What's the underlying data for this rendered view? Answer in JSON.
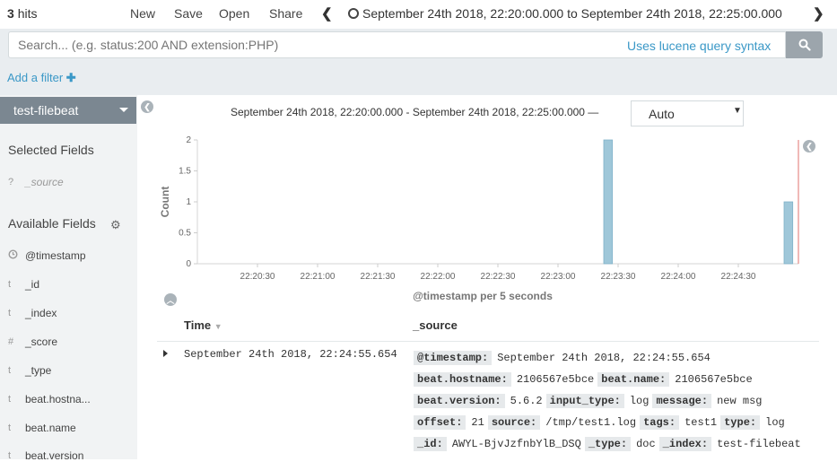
{
  "topbar": {
    "hits_count": "3",
    "hits_label": "hits",
    "menu": [
      "New",
      "Save",
      "Open",
      "Share"
    ],
    "time_range": "September 24th 2018, 22:20:00.000 to September 24th 2018, 22:25:00.000"
  },
  "query": {
    "placeholder": "Search... (e.g. status:200 AND extension:PHP)",
    "lucene_link": "Uses lucene query syntax"
  },
  "filters": {
    "add_filter": "Add a filter"
  },
  "sidebar": {
    "index_pattern": "test-filebeat",
    "selected_heading": "Selected Fields",
    "selected_fields": [
      {
        "type": "?",
        "name": "_source"
      }
    ],
    "available_heading": "Available Fields",
    "available_fields": [
      {
        "type": "clock",
        "name": "@timestamp"
      },
      {
        "type": "t",
        "name": "_id"
      },
      {
        "type": "t",
        "name": "_index"
      },
      {
        "type": "#",
        "name": "_score"
      },
      {
        "type": "t",
        "name": "_type"
      },
      {
        "type": "t",
        "name": "beat.hostna..."
      },
      {
        "type": "t",
        "name": "beat.name"
      },
      {
        "type": "t",
        "name": "beat.version"
      }
    ]
  },
  "histogram": {
    "range_label": "September 24th 2018, 22:20:00.000 - September 24th 2018, 22:25:00.000 —",
    "interval": "Auto"
  },
  "chart_data": {
    "type": "bar",
    "xlabel": "@timestamp per 5 seconds",
    "ylabel": "Count",
    "ylim": [
      0,
      2
    ],
    "yticks": [
      "0",
      "0.5",
      "1",
      "1.5",
      "2"
    ],
    "xticks": [
      "22:20:30",
      "22:21:00",
      "22:21:30",
      "22:22:00",
      "22:22:30",
      "22:23:00",
      "22:23:30",
      "22:24:00",
      "22:24:30"
    ],
    "bars": [
      {
        "x": "22:23:25",
        "value": 2
      },
      {
        "x": "22:24:55",
        "value": 1
      }
    ],
    "marker_color": "#e0736f",
    "bar_color": "#9fc7d9"
  },
  "table": {
    "col_time": "Time",
    "col_source": "_source",
    "rows": [
      {
        "time": "September 24th 2018, 22:24:55.654",
        "source_lines": [
          [
            {
              "k": "@timestamp:",
              "v": "September 24th 2018, 22:24:55.654"
            }
          ],
          [
            {
              "k": "beat.hostname:",
              "v": "2106567e5bce"
            },
            {
              "k": "beat.name:",
              "v": "2106567e5bce"
            }
          ],
          [
            {
              "k": "beat.version:",
              "v": "5.6.2"
            },
            {
              "k": "input_type:",
              "v": "log"
            },
            {
              "k": "message:",
              "v": "new msg"
            }
          ],
          [
            {
              "k": "offset:",
              "v": "21"
            },
            {
              "k": "source:",
              "v": "/tmp/test1.log"
            },
            {
              "k": "tags:",
              "v": "test1"
            },
            {
              "k": "type:",
              "v": "log"
            }
          ],
          [
            {
              "k": "_id:",
              "v": "AWYL-BjvJzfnbYlB_DSQ"
            },
            {
              "k": "_type:",
              "v": "doc"
            },
            {
              "k": "_index:",
              "v": "test-filebeat"
            }
          ]
        ]
      }
    ]
  }
}
